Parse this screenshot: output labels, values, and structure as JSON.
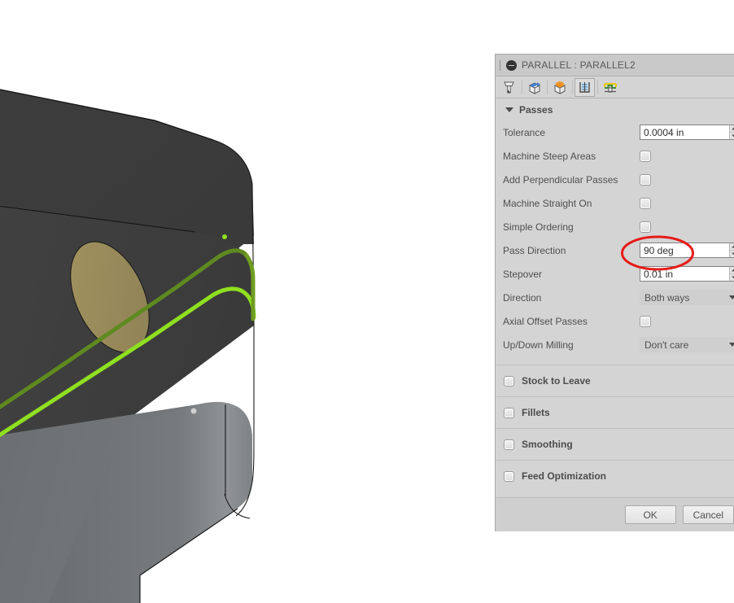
{
  "viewport": {
    "name": "cad-3d-viewport",
    "background": "#ffffff",
    "colors": {
      "top_face": "#3b3b3b",
      "front_face": "#3e3e3e",
      "side_face": "#6e7274",
      "side_face_light": "#8a8e90",
      "hole_face": "#9c8f5e",
      "toolpath_green": "#8fe020",
      "toolpath_green_dark": "#5e8a20",
      "edge": "#111111"
    },
    "marker_dot": "#cfcfcf"
  },
  "dialog": {
    "titlebar": {
      "grip_icon": "drag-grip-icon",
      "status_icon": "suppressed-circle-icon",
      "title": "PARALLEL : PARALLEL2"
    },
    "tabs": [
      {
        "name": "tool-tab",
        "icon": "end-mill-tool-icon",
        "selected": false
      },
      {
        "name": "geometry-tab",
        "icon": "geometry-cube-blue-icon",
        "selected": false
      },
      {
        "name": "heights-tab",
        "icon": "heights-cube-orange-icon",
        "selected": false
      },
      {
        "name": "passes-tab",
        "icon": "passes-stripes-icon",
        "selected": true
      },
      {
        "name": "linking-tab",
        "icon": "linking-ramp-icon",
        "selected": false
      }
    ],
    "passes_section": {
      "label": "Passes",
      "expanded": true,
      "caret": "caret-down-icon"
    },
    "fields": [
      {
        "name": "tolerance",
        "label": "Tolerance",
        "type": "spinner",
        "value": "0.0004 in",
        "placeholder": "0.0004 in"
      },
      {
        "name": "machine-steep-areas",
        "label": "Machine Steep Areas",
        "type": "checkbox",
        "checked": false
      },
      {
        "name": "add-perpendicular-passes",
        "label": "Add Perpendicular Passes",
        "type": "checkbox",
        "checked": false
      },
      {
        "name": "machine-straight-on",
        "label": "Machine Straight On",
        "type": "checkbox",
        "checked": false
      },
      {
        "name": "simple-ordering",
        "label": "Simple Ordering",
        "type": "checkbox",
        "checked": false
      },
      {
        "name": "pass-direction",
        "label": "Pass Direction",
        "type": "spinner",
        "value": "90 deg",
        "placeholder": "90 deg",
        "highlighted": true
      },
      {
        "name": "stepover",
        "label": "Stepover",
        "type": "spinner",
        "value": "0.01 in",
        "placeholder": "0.01 in"
      },
      {
        "name": "direction",
        "label": "Direction",
        "type": "dropdown",
        "value": "Both ways",
        "arrow_icon": "caret-down-icon"
      },
      {
        "name": "axial-offset-passes",
        "label": "Axial Offset Passes",
        "type": "checkbox",
        "checked": false
      },
      {
        "name": "up-down-milling",
        "label": "Up/Down Milling",
        "type": "dropdown",
        "value": "Don't care",
        "arrow_icon": "caret-down-icon"
      }
    ],
    "groups": [
      {
        "name": "stock-to-leave",
        "label": "Stock to Leave",
        "checked": false
      },
      {
        "name": "fillets",
        "label": "Fillets",
        "checked": false
      },
      {
        "name": "smoothing",
        "label": "Smoothing",
        "checked": false
      },
      {
        "name": "feed-optimization",
        "label": "Feed Optimization",
        "checked": false
      }
    ],
    "footer": {
      "ok_label": "OK",
      "cancel_label": "Cancel"
    }
  },
  "annotation": {
    "name": "red-ellipse-highlight",
    "color": "#e51b18",
    "target_field": "pass-direction",
    "stroke_width": 3
  }
}
